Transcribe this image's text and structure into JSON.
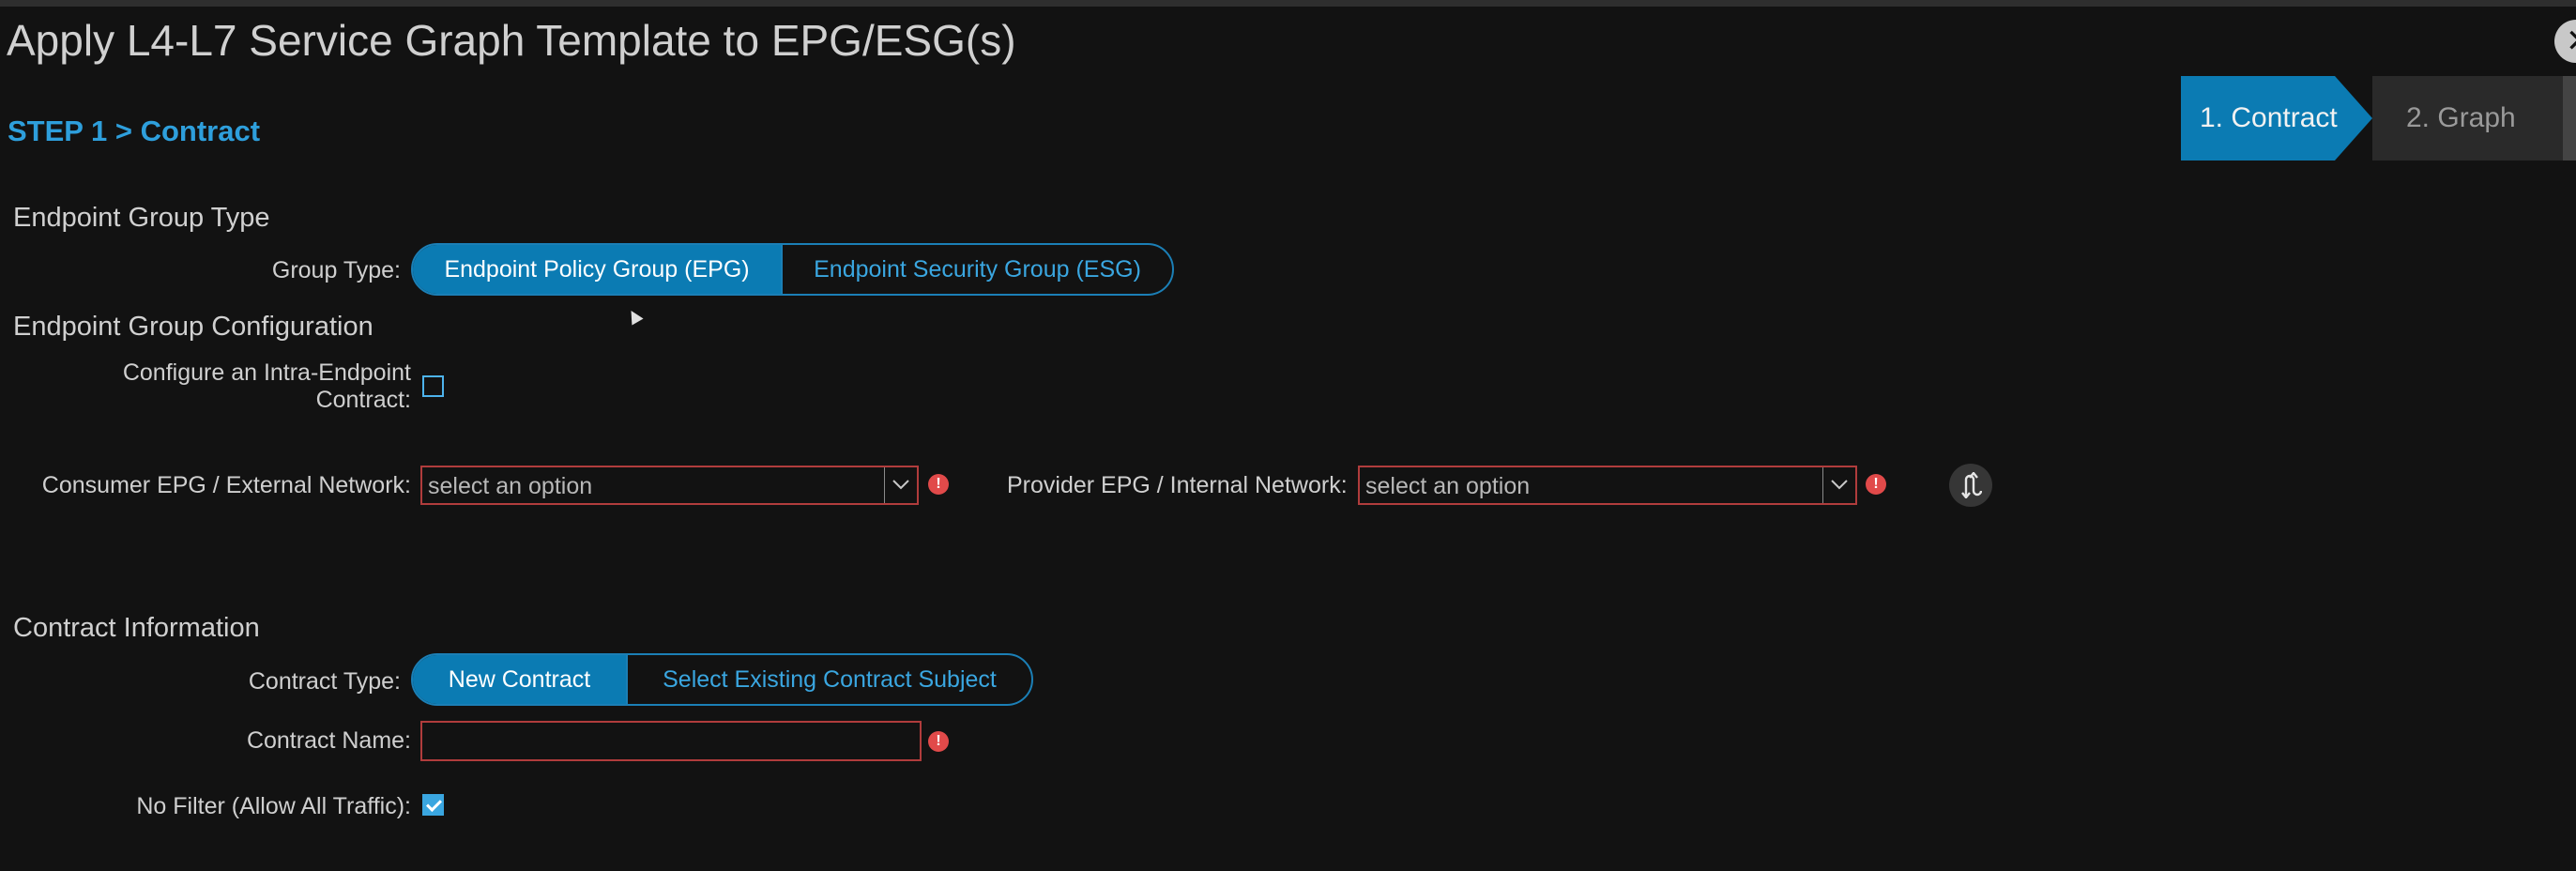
{
  "dialog": {
    "title": "Apply L4-L7 Service Graph Template to EPG/ESG(s)",
    "close_icon": "close-icon",
    "step_label": "STEP 1 > Contract"
  },
  "wizard": {
    "steps": [
      {
        "label": "1. Contract",
        "active": true
      },
      {
        "label": "2. Graph",
        "active": false
      }
    ]
  },
  "endpoint_group_type": {
    "heading": "Endpoint Group Type",
    "group_type_label": "Group Type:",
    "options": [
      "Endpoint Policy Group (EPG)",
      "Endpoint Security Group (ESG)"
    ],
    "selected": "Endpoint Policy Group (EPG)"
  },
  "endpoint_group_config": {
    "heading": "Endpoint Group Configuration",
    "intra_label_line1": "Configure an Intra-Endpoint",
    "intra_label_line2": "Contract:",
    "intra_checked": false,
    "consumer_label": "Consumer EPG / External Network:",
    "consumer_placeholder": "select an option",
    "provider_label": "Provider EPG / Internal Network:",
    "provider_placeholder": "select an option",
    "error_icon": "!",
    "swap_icon": "swap-icon"
  },
  "contract_info": {
    "heading": "Contract Information",
    "contract_type_label": "Contract Type:",
    "options": [
      "New Contract",
      "Select Existing Contract Subject"
    ],
    "selected": "New Contract",
    "contract_name_label": "Contract Name:",
    "contract_name_value": "",
    "no_filter_label": "No Filter (Allow All Traffic):",
    "no_filter_checked": true
  },
  "colors": {
    "background": "#121212",
    "accent": "#0b7bb3",
    "link_blue": "#3aa6e0",
    "error_red": "#e14a4a"
  }
}
